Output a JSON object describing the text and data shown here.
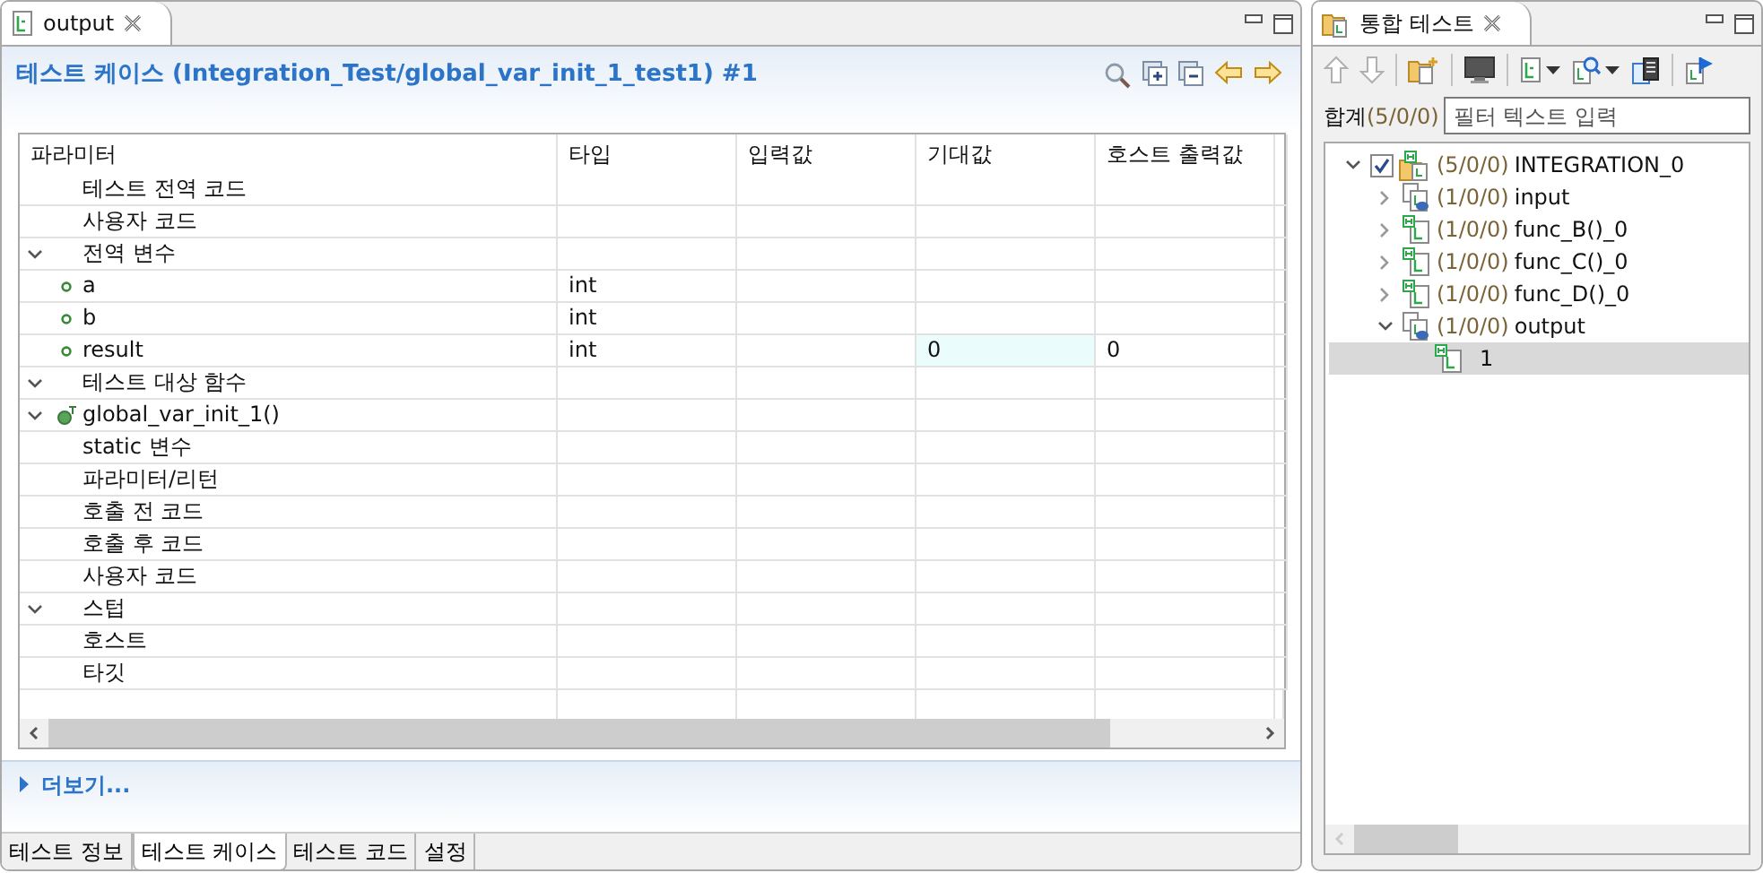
{
  "editor": {
    "tab": {
      "label": "output"
    },
    "title": "테스트 케이스 (Integration_Test/global_var_init_1_test1) #1",
    "table": {
      "columns": [
        "파라미터",
        "타입",
        "입력값",
        "기대값",
        "호스트 출력값"
      ],
      "rows": [
        {
          "label": "테스트 전역 코드"
        },
        {
          "label": "사용자 코드"
        },
        {
          "label": "전역 변수",
          "expanded": true,
          "children": [
            {
              "kind": "variable",
              "label": "a",
              "type": "int"
            },
            {
              "kind": "variable",
              "label": "b",
              "type": "int"
            },
            {
              "kind": "variable",
              "label": "result",
              "type": "int",
              "expected": {
                "text": "0",
                "highlighted": true
              },
              "host_output": "0"
            }
          ]
        },
        {
          "label": "테스트 대상 함수",
          "expanded": true,
          "children": [
            {
              "kind": "function",
              "label": "global_var_init_1()",
              "expanded": true,
              "children": [
                {
                  "label": "static 변수"
                },
                {
                  "label": "파라미터/리턴"
                },
                {
                  "label": "호출 전 코드"
                },
                {
                  "label": "호출 후 코드"
                }
              ]
            }
          ]
        },
        {
          "label": "사용자 코드"
        },
        {
          "label": "스텁",
          "expanded": true,
          "children": [
            {
              "label": "호스트"
            },
            {
              "label": "타깃"
            }
          ]
        }
      ]
    },
    "more": {
      "label": "더보기...",
      "expanded": false
    },
    "tabs": [
      {
        "label": "테스트 정보",
        "selected": false
      },
      {
        "label": "테스트 케이스",
        "selected": true
      },
      {
        "label": "테스트 코드",
        "selected": false
      },
      {
        "label": "설정",
        "selected": false
      }
    ]
  },
  "test_view": {
    "tab": {
      "label": "통합 테스트"
    },
    "toolbar": [
      {
        "kind": "up",
        "disabled": true
      },
      {
        "kind": "down",
        "disabled": true
      },
      {
        "kind": "separator"
      },
      {
        "kind": "new-folder"
      },
      {
        "kind": "separator"
      },
      {
        "kind": "monitor"
      },
      {
        "kind": "separator"
      },
      {
        "kind": "file-menu"
      },
      {
        "kind": "search-menu"
      },
      {
        "kind": "list"
      },
      {
        "kind": "separator"
      },
      {
        "kind": "run"
      }
    ],
    "summary_label": "합계",
    "summary_count": "(5/0/0)",
    "filter": {
      "placeholder": "필터 텍스트 입력"
    },
    "tree": [
      {
        "kind": "integration",
        "count": "(5/0/0)",
        "label": "INTEGRATION_0",
        "checked": true,
        "expanded": true,
        "selected": false,
        "children": [
          {
            "kind": "io",
            "count": "(1/0/0)",
            "label": "input",
            "expanded": false,
            "selected": false
          },
          {
            "kind": "function",
            "count": "(1/0/0)",
            "label": "func_B()_0",
            "expanded": false,
            "selected": false
          },
          {
            "kind": "function",
            "count": "(1/0/0)",
            "label": "func_C()_0",
            "expanded": false,
            "selected": false
          },
          {
            "kind": "function",
            "count": "(1/0/0)",
            "label": "func_D()_0",
            "expanded": false,
            "selected": false
          },
          {
            "kind": "io",
            "count": "(1/0/0)",
            "label": "output",
            "expanded": true,
            "selected": false,
            "children": [
              {
                "kind": "case",
                "label": "1",
                "selected": true
              }
            ]
          }
        ]
      }
    ]
  }
}
